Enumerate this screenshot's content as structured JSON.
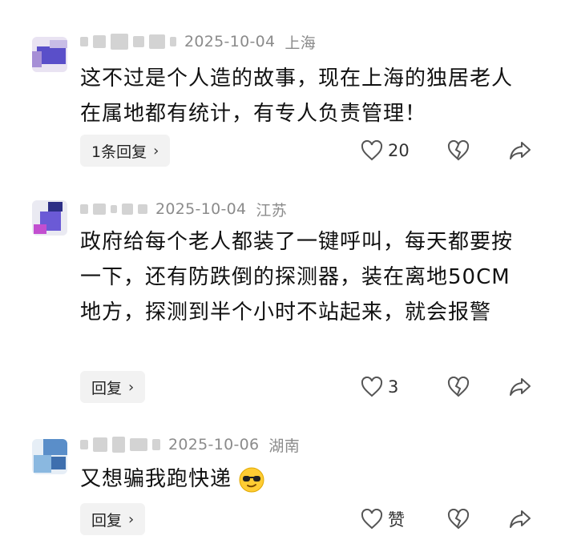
{
  "comments": [
    {
      "date": "2025-10-04",
      "location": "上海",
      "text": "这不过是个人造的故事，现在上海的独居老人在属地都有统计，有专人负责管理！",
      "reply_label": "1条回复",
      "like_count": "20"
    },
    {
      "date": "2025-10-04",
      "location": "江苏",
      "text": "政府给每个老人都装了一键呼叫，每天都要按一下，还有防跌倒的探测器，装在离地50CM地方，探测到半个小时不站起来，就会报警",
      "reply_label": "回复",
      "like_count": "3"
    },
    {
      "date": "2025-10-06",
      "location": "湖南",
      "text": "又想骗我跑快递",
      "emoji": "cool-sunglasses-emoji",
      "reply_label": "回复",
      "like_count": "赞"
    }
  ],
  "icons": {
    "like": "heart-outline-icon",
    "dislike": "broken-heart-icon",
    "share": "share-arrow-icon",
    "chevron": "chevron-right-icon"
  },
  "colors": {
    "meta_gray": "#8b8b8b",
    "pill_bg": "#f2f2f2",
    "text": "#111111"
  }
}
